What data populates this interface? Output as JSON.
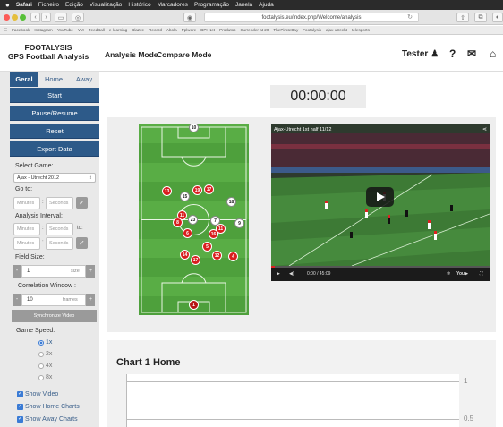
{
  "os_menubar": {
    "apple": "",
    "app": "Safari",
    "items": [
      "Ficheiro",
      "Edição",
      "Visualização",
      "Histórico",
      "Marcadores",
      "Programação",
      "Janela",
      "Ajuda"
    ]
  },
  "browser": {
    "url": "footalysis.eu/index.php/Welcome/analysis",
    "bookmarks": [
      "Facebook",
      "Instagram",
      "YouTube",
      "VM",
      "FeedBall",
      "e-learning",
      "Blazze",
      "Record",
      "Abola",
      "Pplware",
      "BPI Net",
      "Produtos",
      "Surrender at 20",
      "ThePirateBay",
      "Footalysis",
      "ajax-utrecht",
      "telesports"
    ]
  },
  "header": {
    "brand_line1": "FOOTALYSIS",
    "brand_line2": "GPS Football Analysis",
    "nav": [
      "Analysis Mode",
      "Compare Mode"
    ],
    "user": "Tester"
  },
  "sidebar": {
    "tabs": [
      "Geral",
      "Home",
      "Away"
    ],
    "buttons": [
      "Start",
      "Pause/Resume",
      "Reset",
      "Export Data"
    ],
    "select_game_label": "Select Game:",
    "select_game_value": "Ajax - Utrecht 2012",
    "goto_label": "Go to:",
    "minutes_placeholder": "Minutes",
    "seconds_placeholder": "Seconds",
    "interval_label": "Analysis Interval:",
    "to_label": "to:",
    "field_size_label": "Field Size:",
    "field_size_value": "1",
    "field_size_unit": "size",
    "corr_label": "Correlation Window :",
    "corr_value": "10",
    "corr_unit": "frames",
    "sync_button": "Synchronize Video",
    "speed_label": "Game Speed:",
    "speeds": [
      "1x",
      "2x",
      "4x",
      "8x"
    ],
    "selected_speed": "1x",
    "checks": [
      "Show Video",
      "Show Home Charts",
      "Show Away Charts"
    ]
  },
  "main": {
    "timer": "00:00:00",
    "video_title": "Ajax-Utrecht 1st half 11/12",
    "video_time": "0:00 / 45:09",
    "chart_title": "Chart 1 Home",
    "chart_data": {
      "type": "line",
      "title": "Chart 1 Home",
      "yticks": [
        1,
        0.5
      ]
    },
    "players": [
      {
        "num": "10",
        "team": "white"
      },
      {
        "num": "13",
        "team": "red"
      },
      {
        "num": "15",
        "team": "white"
      },
      {
        "num": "19",
        "team": "red"
      },
      {
        "num": "17",
        "team": "red"
      },
      {
        "num": "18",
        "team": "white"
      },
      {
        "num": "11",
        "team": "red"
      },
      {
        "num": "23",
        "team": "white"
      },
      {
        "num": "7",
        "team": "white"
      },
      {
        "num": "9",
        "team": "white"
      },
      {
        "num": "8",
        "team": "red"
      },
      {
        "num": "11",
        "team": "red"
      },
      {
        "num": "16",
        "team": "red"
      },
      {
        "num": "6",
        "team": "red"
      },
      {
        "num": "5",
        "team": "red"
      },
      {
        "num": "14",
        "team": "red"
      },
      {
        "num": "17",
        "team": "red"
      },
      {
        "num": "12",
        "team": "red"
      },
      {
        "num": "4",
        "team": "red"
      }
    ]
  }
}
